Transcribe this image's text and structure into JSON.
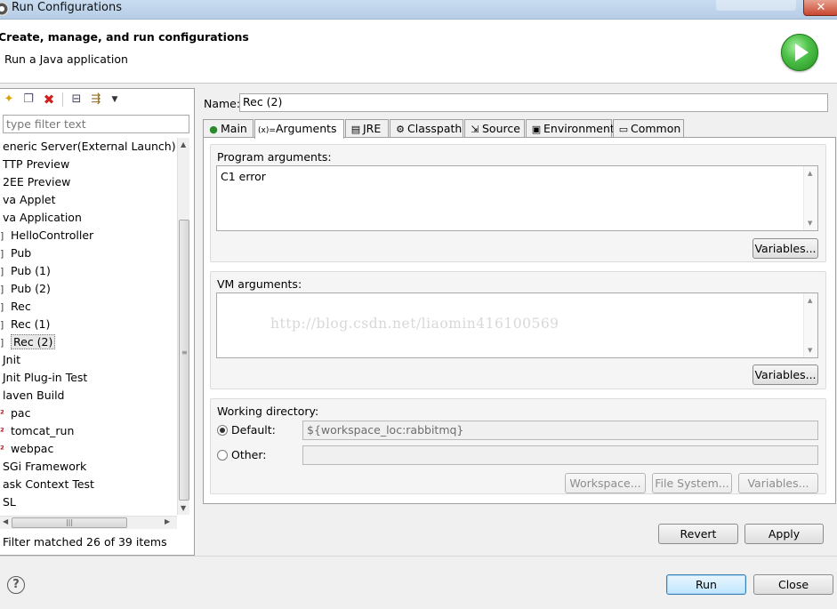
{
  "window": {
    "title": "Run Configurations",
    "close_glyph": "✕"
  },
  "header": {
    "title": "Create, manage, and run configurations",
    "subtitle": "Run a Java application"
  },
  "left": {
    "toolbar_icons": [
      "new-launch-config-icon",
      "duplicate-icon",
      "delete-icon",
      "collapse-all-icon",
      "filter-icon",
      "dropdown-arrow-icon"
    ],
    "filter_placeholder": "type filter text",
    "tree": [
      {
        "label": "eneric Server(External Launch)",
        "child": false
      },
      {
        "label": "TTP Preview",
        "child": false
      },
      {
        "label": "2EE Preview",
        "child": false
      },
      {
        "label": "va Applet",
        "child": false
      },
      {
        "label": "va Application",
        "child": false
      },
      {
        "label": "HelloController",
        "child": true,
        "marker": "]"
      },
      {
        "label": "Pub",
        "child": true,
        "marker": "]"
      },
      {
        "label": "Pub (1)",
        "child": true,
        "marker": "]"
      },
      {
        "label": "Pub (2)",
        "child": true,
        "marker": "]"
      },
      {
        "label": "Rec",
        "child": true,
        "marker": "]"
      },
      {
        "label": "Rec (1)",
        "child": true,
        "marker": "]"
      },
      {
        "label": "Rec (2)",
        "child": true,
        "marker": "]",
        "selected": true
      },
      {
        "label": "Jnit",
        "child": false
      },
      {
        "label": "Jnit Plug-in Test",
        "child": false
      },
      {
        "label": "laven Build",
        "child": false
      },
      {
        "label": "pac",
        "child": true,
        "marker": "²",
        "red": true
      },
      {
        "label": "tomcat_run",
        "child": true,
        "marker": "²",
        "red": true
      },
      {
        "label": "webpac",
        "child": true,
        "marker": "²",
        "red": true
      },
      {
        "label": "SGi Framework",
        "child": false
      },
      {
        "label": "ask Context Test",
        "child": false
      },
      {
        "label": "SL",
        "child": false
      }
    ],
    "status": "Filter matched 26 of 39 items"
  },
  "right": {
    "name_label": "Name:",
    "name_value": "Rec (2)",
    "tabs": [
      {
        "label": "Main",
        "icon": "main-tab-icon",
        "glyph": "●"
      },
      {
        "label": "Arguments",
        "icon": "arguments-tab-icon",
        "glyph": "(x)="
      },
      {
        "label": "JRE",
        "icon": "jre-tab-icon",
        "glyph": "▤"
      },
      {
        "label": "Classpath",
        "icon": "classpath-tab-icon",
        "glyph": "⚙"
      },
      {
        "label": "Source",
        "icon": "source-tab-icon",
        "glyph": "⇲"
      },
      {
        "label": "Environment",
        "icon": "environment-tab-icon",
        "glyph": "▣"
      },
      {
        "label": "Common",
        "icon": "common-tab-icon",
        "glyph": "▭"
      }
    ],
    "program_args": {
      "label": "Program arguments:",
      "value": "C1 error",
      "variables_label": "Variables..."
    },
    "vm_args": {
      "label": "VM arguments:",
      "value": "",
      "watermark": "http://blog.csdn.net/liaomin416100569",
      "variables_label": "Variables..."
    },
    "working_dir": {
      "label": "Working directory:",
      "default_label": "Default:",
      "default_value": "${workspace_loc:rabbitmq}",
      "other_label": "Other:",
      "other_value": "",
      "workspace_label": "Workspace...",
      "filesystem_label": "File System...",
      "variables_label": "Variables..."
    },
    "revert_label": "Revert",
    "apply_label": "Apply"
  },
  "footer": {
    "help_glyph": "?",
    "run_label": "Run",
    "close_label": "Close"
  },
  "colors": {
    "accent": "#3c7fb1",
    "run_green": "#4fc24a",
    "delete_red": "#c0142b"
  }
}
